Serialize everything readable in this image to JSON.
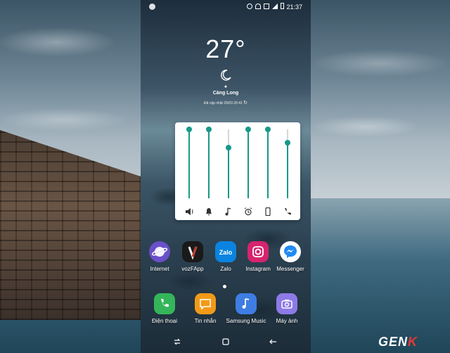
{
  "status_bar": {
    "time": "21:37"
  },
  "weather": {
    "temperature": "27°",
    "location": "Càng Long",
    "updated": "Đã cập nhật 25/03 20:41"
  },
  "volume_panel": {
    "channels": [
      {
        "name": "media-volume",
        "level": 1.0
      },
      {
        "name": "notification-volume",
        "level": 1.0
      },
      {
        "name": "ringtone-music-volume",
        "level": 0.73
      },
      {
        "name": "alarm-volume",
        "level": 1.0
      },
      {
        "name": "system-volume",
        "level": 1.0
      },
      {
        "name": "call-volume",
        "level": 0.81
      }
    ],
    "accent_color": "#189889"
  },
  "apps_row1": [
    {
      "label": "Internet",
      "icon": "internet-icon",
      "color": "#6a4fc9"
    },
    {
      "label": "vozFApp",
      "icon": "vozfapp-icon",
      "color": "#1a1a1a"
    },
    {
      "label": "Zalo",
      "icon": "zalo-icon",
      "color": "#0a84e0"
    },
    {
      "label": "Instagram",
      "icon": "instagram-icon",
      "color": "#d6246e"
    },
    {
      "label": "Messenger",
      "icon": "messenger-icon",
      "color": "#ffffff"
    }
  ],
  "apps_row2": [
    {
      "label": "Điện thoại",
      "icon": "phone-icon",
      "color": "#34b55a"
    },
    {
      "label": "Tin nhắn",
      "icon": "messages-icon",
      "color": "#f29a17"
    },
    {
      "label": "Samsung Music",
      "icon": "music-icon",
      "color": "#3e7de3"
    },
    {
      "label": "Máy ảnh",
      "icon": "camera-icon",
      "color": "#8d7ae6"
    }
  ],
  "watermark": {
    "text_main": "GEN",
    "text_accent": "K"
  }
}
